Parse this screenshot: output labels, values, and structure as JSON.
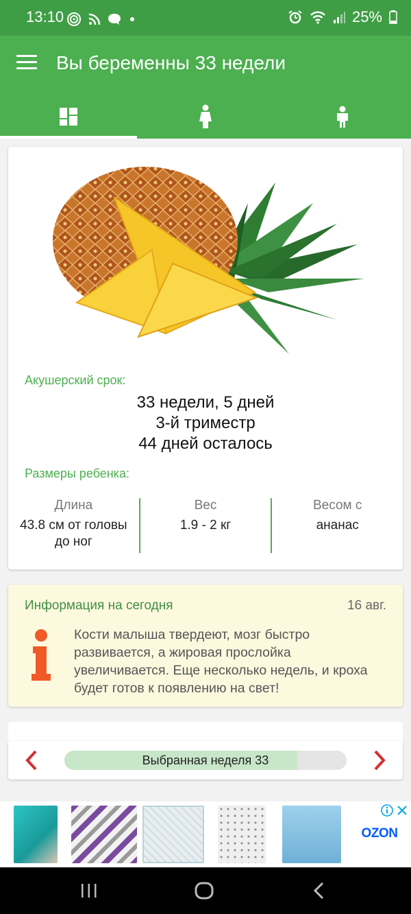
{
  "status": {
    "time": "13:10",
    "battery": "25%"
  },
  "appbar": {
    "title": "Вы беременны 33 недели"
  },
  "tabs": [
    {
      "name": "dashboard-icon"
    },
    {
      "name": "mother-icon"
    },
    {
      "name": "baby-icon"
    }
  ],
  "summary": {
    "image_subject": "ананас",
    "term_label": "Акушерский срок:",
    "weeks_days": "33 недели, 5 дней",
    "trimester": "3-й триместр",
    "days_left": "44 дней осталось",
    "sizes_label": "Размеры ребенка:",
    "length_header": "Длина",
    "length_value": "43.8 см от головы до ног",
    "weight_header": "Вес",
    "weight_value": "1.9 - 2 кг",
    "compare_header": "Весом с",
    "compare_value": "ананас"
  },
  "info": {
    "title": "Информация на сегодня",
    "date": "16 авг.",
    "text": "Кости малыша твердеют, мозг быстро развивается, а жировая прослойка увеличивается. Еще несколько недель, и кроха будет готов к появлению на свет!"
  },
  "week_nav": {
    "label": "Выбранная неделя 33",
    "progress_fraction": 0.825
  },
  "ads": {
    "brand": "OZON"
  },
  "colors": {
    "status_bar": "#3f9e45",
    "app_bar": "#4caf50",
    "accent_green": "#4caf50",
    "info_bg": "#fdf9df",
    "info_icon": "#f05a28",
    "arrow_red": "#d32f2f",
    "ozon_blue": "#005bff"
  }
}
